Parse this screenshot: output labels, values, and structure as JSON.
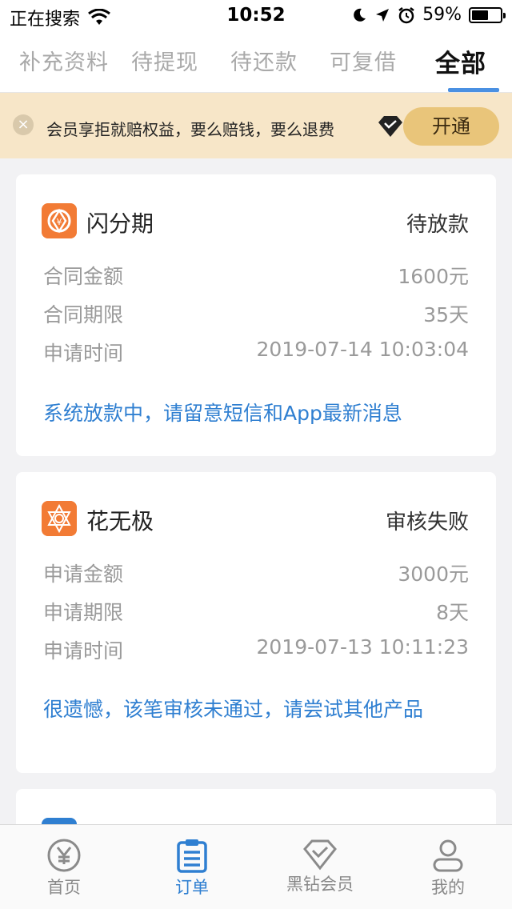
{
  "status_bar": {
    "carrier": "正在搜索",
    "time": "10:52",
    "battery": "59%",
    "battery_level": 0.59
  },
  "tabs": [
    {
      "label": "补充资料",
      "active": false
    },
    {
      "label": "待提现",
      "active": false
    },
    {
      "label": "待还款",
      "active": false
    },
    {
      "label": "可复借",
      "active": false
    },
    {
      "label": "全部",
      "active": true
    }
  ],
  "banner": {
    "text": "会员享拒就赔权益，要么赔钱，要么退费",
    "button": "开通"
  },
  "cards": [
    {
      "name": "闪分期",
      "status": "待放款",
      "rows": [
        {
          "label": "合同金额",
          "value": "1600元"
        },
        {
          "label": "合同期限",
          "value": "35天"
        },
        {
          "label": "申请时间",
          "value": "2019-07-14 10:03:04"
        }
      ],
      "message": "系统放款中，请留意短信和App最新消息"
    },
    {
      "name": "花无极",
      "status": "审核失败",
      "rows": [
        {
          "label": "申请金额",
          "value": "3000元"
        },
        {
          "label": "申请期限",
          "value": "8天"
        },
        {
          "label": "申请时间",
          "value": "2019-07-13 10:11:23"
        }
      ],
      "message": "很遗憾，该笔审核未通过，请尝试其他产品"
    }
  ],
  "bottom_nav": [
    {
      "label": "首页",
      "icon": "yen-circle-icon",
      "active": false
    },
    {
      "label": "订单",
      "icon": "order-list-icon",
      "active": true
    },
    {
      "label": "黑钻会员",
      "icon": "diamond-icon",
      "active": false
    },
    {
      "label": "我的",
      "icon": "person-icon",
      "active": false
    }
  ],
  "colors": {
    "accent": "#2f7fd1",
    "banner_bg": "#f7e6c8",
    "banner_button": "#e9c57a",
    "logo_orange": "#f27b35"
  }
}
